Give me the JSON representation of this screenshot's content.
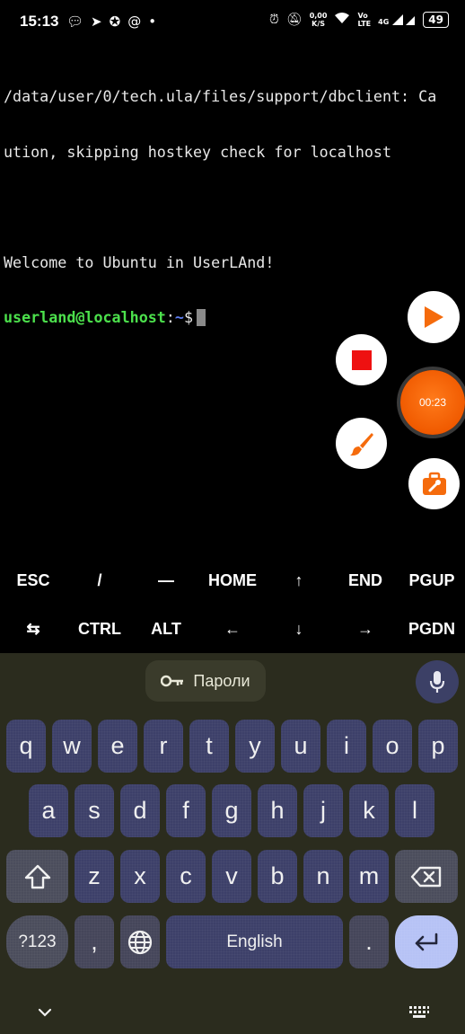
{
  "status_bar": {
    "time": "15:13",
    "net_speed_value": "0,00",
    "net_speed_unit": "K/S",
    "volte_top": "Vo",
    "volte_bottom": "LTE",
    "signal_label": "4G",
    "battery": "49"
  },
  "terminal": {
    "lines": [
      "/data/user/0/tech.ula/files/support/dbclient: Ca",
      "ution, skipping hostkey check for localhost",
      "",
      "Welcome to Ubuntu in UserLAnd!"
    ],
    "prompt_user": "userland@localhost",
    "prompt_sep": ":",
    "prompt_path": "~",
    "prompt_symbol": "$"
  },
  "recorder": {
    "timer": "00:23"
  },
  "extra_keys": {
    "row1": [
      "ESC",
      "/",
      "—",
      "HOME",
      "↑",
      "END",
      "PGUP"
    ],
    "row2": [
      "⇆",
      "CTRL",
      "ALT",
      "←",
      "↓",
      "→",
      "PGDN"
    ]
  },
  "keyboard": {
    "passwords_label": "Пароли",
    "row1": [
      "q",
      "w",
      "e",
      "r",
      "t",
      "y",
      "u",
      "i",
      "o",
      "p"
    ],
    "row2": [
      "a",
      "s",
      "d",
      "f",
      "g",
      "h",
      "j",
      "k",
      "l"
    ],
    "row3": [
      "z",
      "x",
      "c",
      "v",
      "b",
      "n",
      "m"
    ],
    "symbols_label": "?123",
    "comma": ",",
    "space_label": "English",
    "period": "."
  },
  "colors": {
    "terminal_bg": "#000000",
    "prompt_user": "#4ce04c",
    "prompt_path": "#5c7cf0",
    "key_bg": "#3d4069",
    "keyboard_bg": "#2b2c1e",
    "enter_key": "#b6c2f5",
    "recorder_orange": "#f05a00"
  }
}
